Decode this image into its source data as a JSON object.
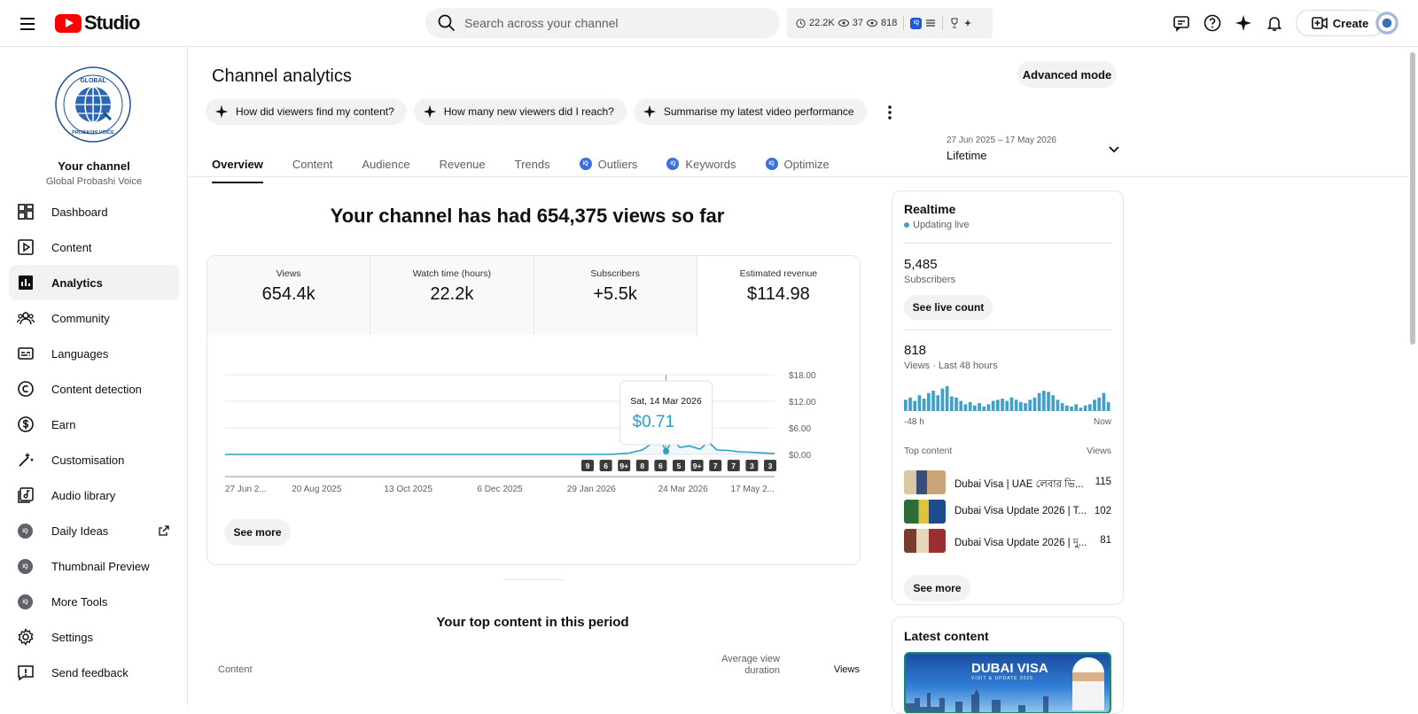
{
  "header": {
    "logo_text": "Studio",
    "search_placeholder": "Search across your channel",
    "stats": {
      "watch": "22.2K",
      "views_a": "37",
      "views_b": "818"
    },
    "create_label": "Create"
  },
  "sidebar": {
    "channel_title": "Your channel",
    "channel_name": "Global Probashi Voice",
    "logo_text_top": "GLOBAL",
    "logo_text_bottom": "PROBASHI VOICE",
    "items": [
      {
        "label": "Dashboard"
      },
      {
        "label": "Content"
      },
      {
        "label": "Analytics"
      },
      {
        "label": "Community"
      },
      {
        "label": "Languages"
      },
      {
        "label": "Content detection"
      },
      {
        "label": "Earn"
      },
      {
        "label": "Customisation"
      },
      {
        "label": "Audio library"
      },
      {
        "label": "Daily Ideas"
      },
      {
        "label": "Thumbnail Preview"
      },
      {
        "label": "More Tools"
      },
      {
        "label": "Settings"
      },
      {
        "label": "Send feedback"
      }
    ]
  },
  "main": {
    "title": "Channel analytics",
    "advanced_label": "Advanced mode",
    "chips": [
      {
        "label": "How did viewers find my content?"
      },
      {
        "label": "How many new viewers did I reach?"
      },
      {
        "label": "Summarise my latest video performance"
      }
    ],
    "tabs": [
      {
        "label": "Overview"
      },
      {
        "label": "Content"
      },
      {
        "label": "Audience"
      },
      {
        "label": "Revenue"
      },
      {
        "label": "Trends"
      },
      {
        "label": "Outliers"
      },
      {
        "label": "Keywords"
      },
      {
        "label": "Optimize"
      }
    ],
    "date_range": "27 Jun 2025 – 17 May 2026",
    "period": "Lifetime",
    "headline": "Your channel has had 654,375 views so far",
    "metrics": [
      {
        "label": "Views",
        "value": "654.4k"
      },
      {
        "label": "Watch time (hours)",
        "value": "22.2k"
      },
      {
        "label": "Subscribers",
        "value": "+5.5k"
      },
      {
        "label": "Estimated revenue",
        "value": "$114.98"
      }
    ],
    "see_more": "See more",
    "top_content_title": "Your top content in this period",
    "table_headers": {
      "content": "Content",
      "avd": "Average view duration",
      "views": "Views"
    }
  },
  "chart_data": {
    "type": "line",
    "series_label": "Estimated revenue",
    "x_ticks": [
      "27 Jun 2...",
      "20 Aug 2025",
      "13 Oct 2025",
      "6 Dec 2025",
      "29 Jan 2026",
      "24 Mar 2026",
      "17 May 2..."
    ],
    "y_ticks": [
      "$18.00",
      "$12.00",
      "$6.00",
      "$0.00"
    ],
    "ylim": [
      0,
      18
    ],
    "x_range": [
      "2025-06-27",
      "2026-05-17"
    ],
    "points": [
      [
        "2025-06-27",
        0
      ],
      [
        "2026-01-28",
        0
      ],
      [
        "2026-02-10",
        0.05
      ],
      [
        "2026-02-20",
        0.3
      ],
      [
        "2026-02-28",
        1.0
      ],
      [
        "2026-03-06",
        2.6
      ],
      [
        "2026-03-10",
        4.0
      ],
      [
        "2026-03-14",
        0.71
      ],
      [
        "2026-03-18",
        3.5
      ],
      [
        "2026-03-22",
        1.6
      ],
      [
        "2026-03-28",
        1.9
      ],
      [
        "2026-04-03",
        1.2
      ],
      [
        "2026-04-08",
        2.8
      ],
      [
        "2026-04-13",
        1.0
      ],
      [
        "2026-04-20",
        0.9
      ],
      [
        "2026-04-26",
        0.6
      ],
      [
        "2026-05-03",
        0.5
      ],
      [
        "2026-05-10",
        0.35
      ],
      [
        "2026-05-17",
        0.2
      ]
    ],
    "tooltip": {
      "date": "Sat, 14 Mar 2026",
      "value": "$0.71"
    },
    "video_markers": [
      "9",
      "6",
      "9+",
      "8",
      "6",
      "5",
      "9+",
      "7",
      "7",
      "3",
      "3"
    ],
    "grid": true
  },
  "realtime": {
    "title": "Realtime",
    "live_label": "Updating live",
    "subs_value": "5,485",
    "subs_label": "Subscribers",
    "live_count_button": "See live count",
    "views_value": "818",
    "views_label": "Views · Last 48 hours",
    "bars": [
      10,
      12,
      9,
      14,
      11,
      16,
      18,
      14,
      20,
      22,
      13,
      12,
      9,
      6,
      8,
      5,
      7,
      4,
      6,
      9,
      10,
      11,
      9,
      12,
      10,
      8,
      7,
      10,
      12,
      16,
      18,
      17,
      14,
      10,
      7,
      5,
      4,
      6,
      3,
      5,
      6,
      10,
      12,
      16,
      8
    ],
    "axis_start": "-48 h",
    "axis_end": "Now",
    "top_content_label": "Top content",
    "top_views_label": "Views",
    "top_items": [
      {
        "title": "Dubai Visa | UAE লেবার ভি...",
        "views": "115"
      },
      {
        "title": "Dubai Visa Update 2026 | T...",
        "views": "102"
      },
      {
        "title": "Dubai Visa Update 2026 | দু...",
        "views": "81"
      }
    ],
    "see_more": "See more"
  },
  "latest": {
    "title": "Latest content",
    "thumb_text": "DUBAI VISA",
    "thumb_sub": "VISIT & UPDATE 2026"
  }
}
